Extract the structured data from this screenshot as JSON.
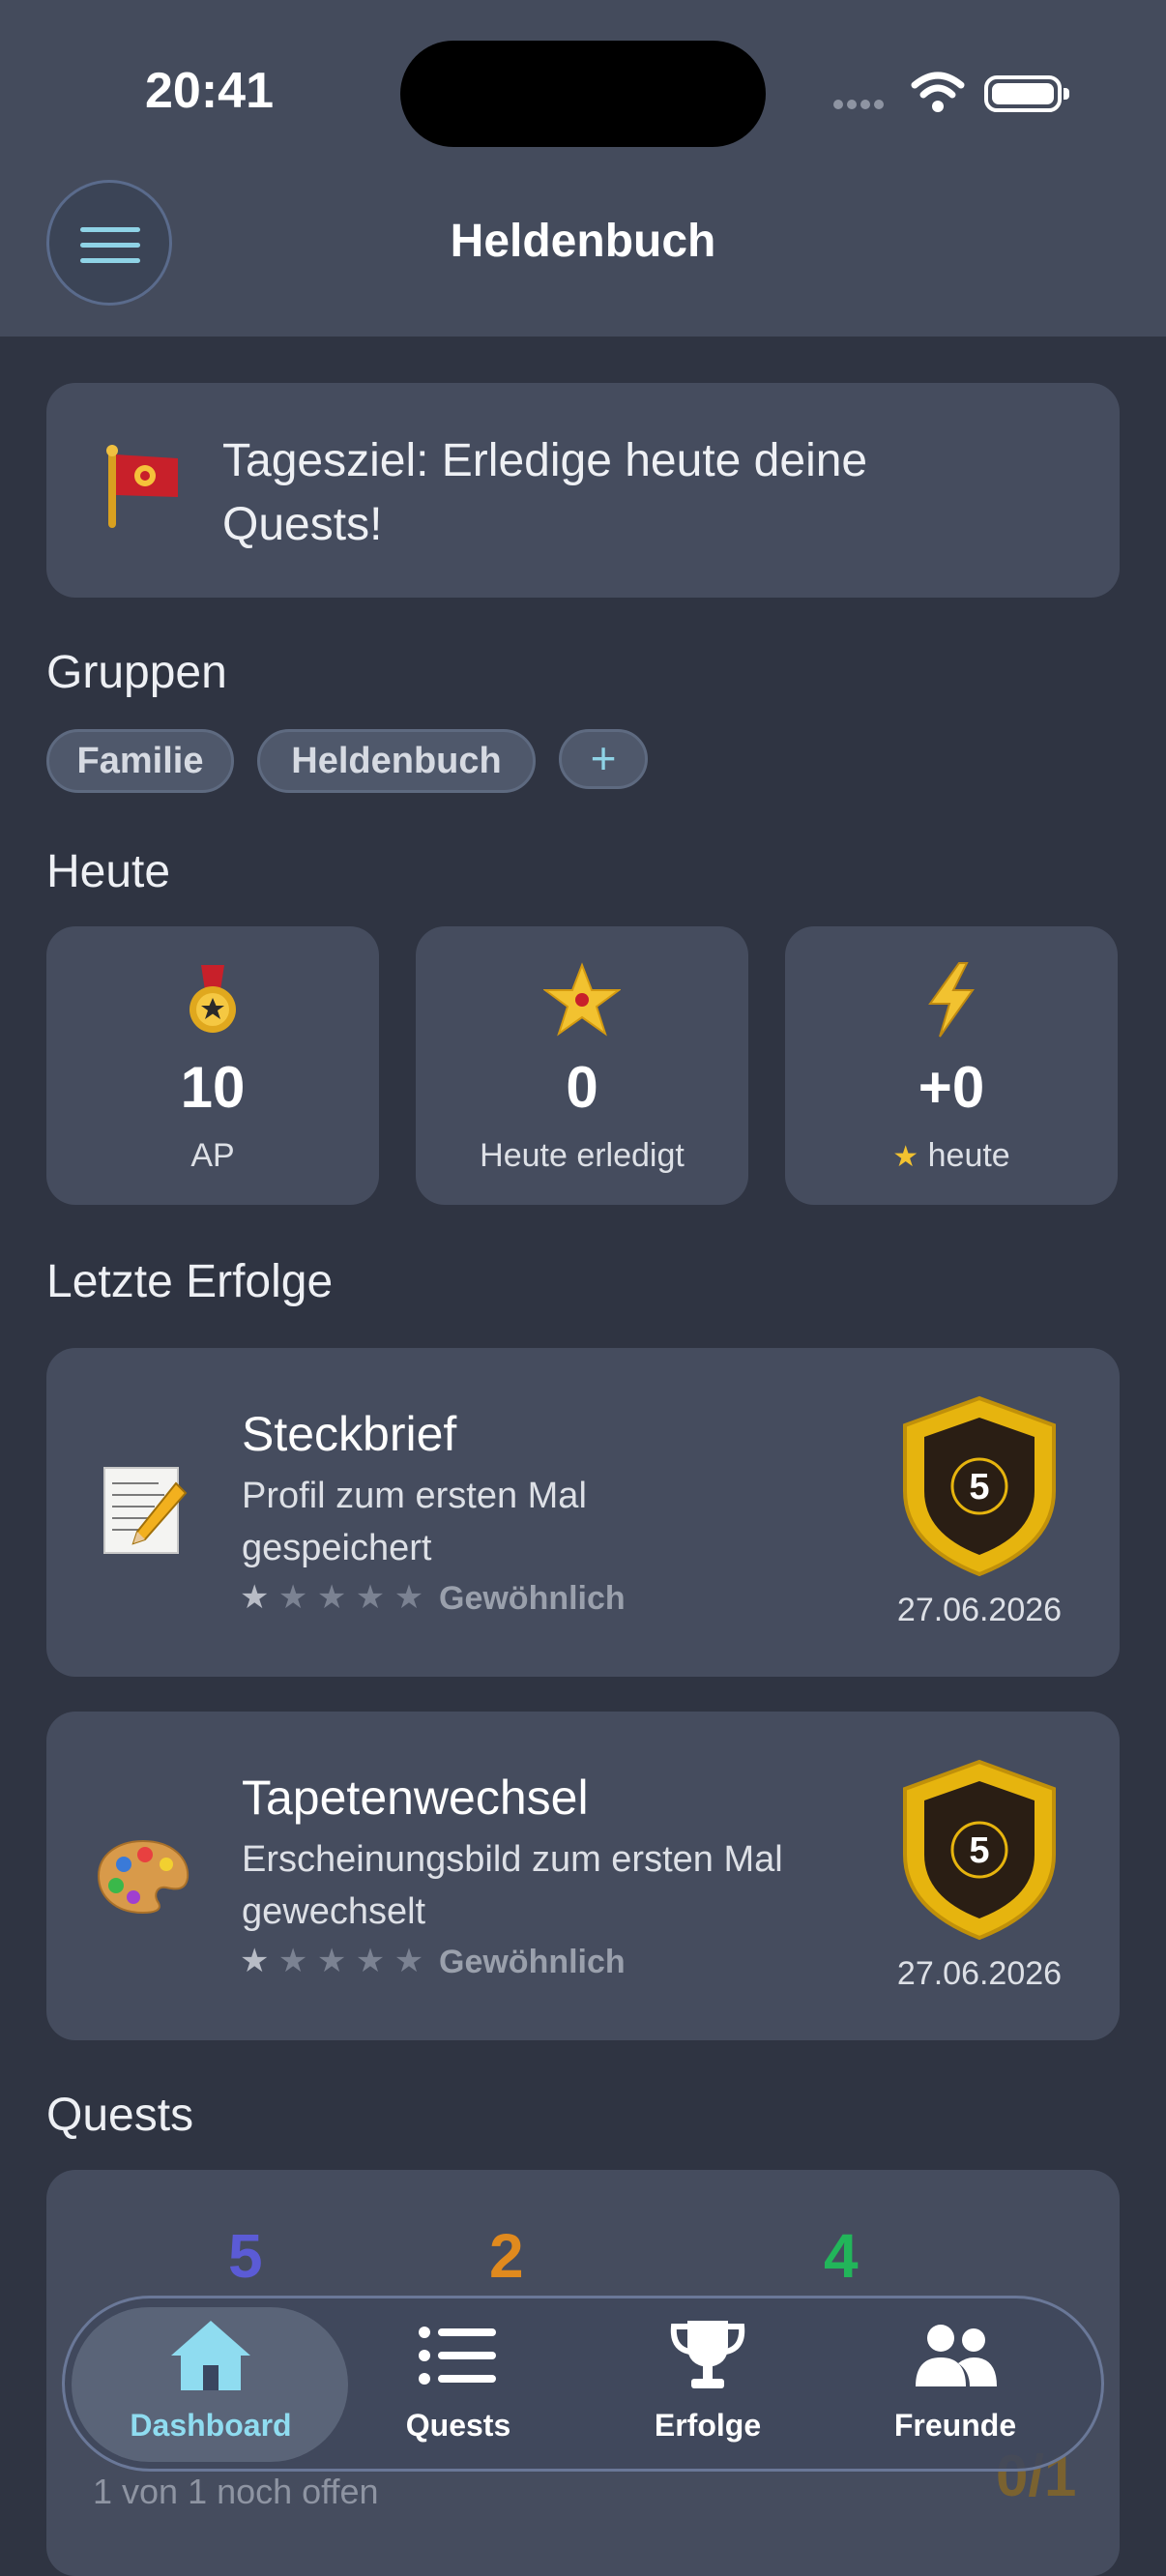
{
  "status": {
    "time": "20:41"
  },
  "header": {
    "title": "Heldenbuch"
  },
  "goal": {
    "text": "Tagesziel: Erledige heute deine Quests!"
  },
  "groups": {
    "heading": "Gruppen",
    "chips": [
      "Familie",
      "Heldenbuch"
    ],
    "add_label": "+"
  },
  "today": {
    "heading": "Heute",
    "stats": [
      {
        "icon": "medal-icon",
        "value": "10",
        "label": "AP"
      },
      {
        "icon": "star-icon",
        "value": "0",
        "label": "Heute erledigt"
      },
      {
        "icon": "lightning-icon",
        "value": "+0",
        "label": "heute"
      }
    ]
  },
  "achievements": {
    "heading": "Letzte Erfolge",
    "items": [
      {
        "icon": "memo-icon",
        "title": "Steckbrief",
        "description": "Profil zum ersten Mal gespeichert",
        "stars_filled": 1,
        "stars_total": 5,
        "rarity": "Gewöhnlich",
        "badge_value": "5",
        "date": "27.06.2026"
      },
      {
        "icon": "palette-icon",
        "title": "Tapetenwechsel",
        "description": "Erscheinungsbild zum ersten Mal gewechselt",
        "stars_filled": 1,
        "stars_total": 5,
        "rarity": "Gewöhnlich",
        "badge_value": "5",
        "date": "27.06.2026"
      }
    ]
  },
  "quests": {
    "heading": "Quests",
    "counts": [
      {
        "value": "5",
        "color": "#5b5bd6"
      },
      {
        "value": "2",
        "color": "#e08a1e"
      },
      {
        "value": "4",
        "color": "#22b55a"
      }
    ],
    "subtitle": "1 von 1 noch offen",
    "ratio": "0/1"
  },
  "tabs": [
    {
      "label": "Dashboard",
      "icon": "house-icon",
      "active": true
    },
    {
      "label": "Quests",
      "icon": "list-icon",
      "active": false
    },
    {
      "label": "Erfolge",
      "icon": "trophy-icon",
      "active": false
    },
    {
      "label": "Freunde",
      "icon": "people-icon",
      "active": false
    }
  ],
  "colors": {
    "background": "#2f3442",
    "card": "#454c5e",
    "accent": "#8fd3e6"
  }
}
